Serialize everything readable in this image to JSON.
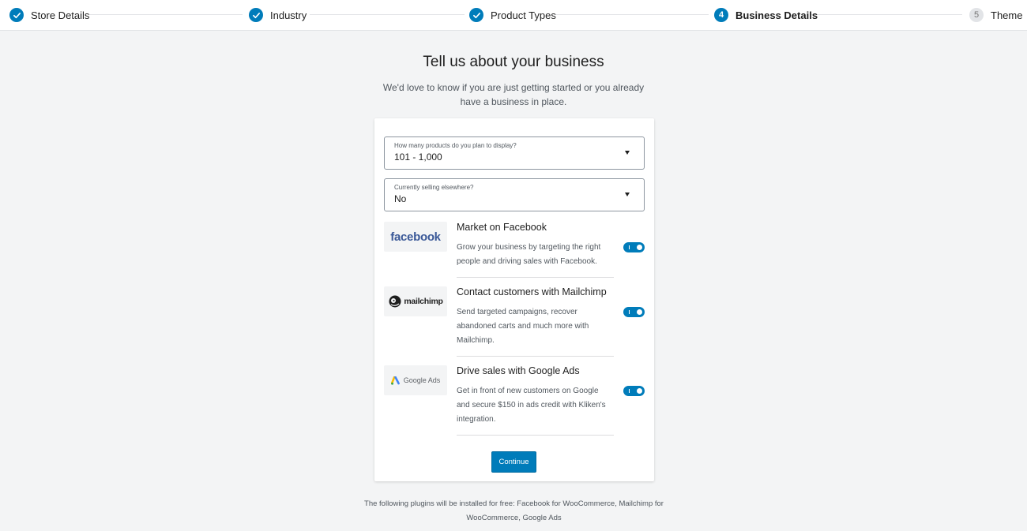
{
  "stepper": {
    "steps": [
      {
        "label": "Store Details",
        "state": "done"
      },
      {
        "label": "Industry",
        "state": "done"
      },
      {
        "label": "Product Types",
        "state": "done"
      },
      {
        "label": "Business Details",
        "number": "4",
        "state": "current"
      },
      {
        "label": "Theme",
        "number": "5",
        "state": "pending"
      }
    ]
  },
  "header": {
    "title": "Tell us about your business",
    "subtitle": "We'd love to know if you are just getting started or you already have a business in place."
  },
  "form": {
    "products_select": {
      "label": "How many products do you plan to display?",
      "value": "101 - 1,000"
    },
    "selling_select": {
      "label": "Currently selling elsewhere?",
      "value": "No"
    },
    "plugins": [
      {
        "logo_text": "facebook",
        "title": "Market on Facebook",
        "description": "Grow your business by targeting the right people and driving sales with Facebook.",
        "enabled": true
      },
      {
        "logo_text": "mailchimp",
        "title": "Contact customers with Mailchimp",
        "description": "Send targeted campaigns, recover abandoned carts and much more with Mailchimp.",
        "enabled": true
      },
      {
        "logo_text": "Google Ads",
        "title": "Drive sales with Google Ads",
        "description": "Get in front of new customers on Google and secure $150 in ads credit with Kliken's integration.",
        "enabled": true
      }
    ],
    "continue_label": "Continue"
  },
  "footnote": "The following plugins will be installed for free: Facebook for WooCommerce, Mailchimp for WooCommerce, Google Ads",
  "colors": {
    "accent": "#007cba",
    "background": "#f3f4f5",
    "facebook_brand": "#3b5998"
  }
}
